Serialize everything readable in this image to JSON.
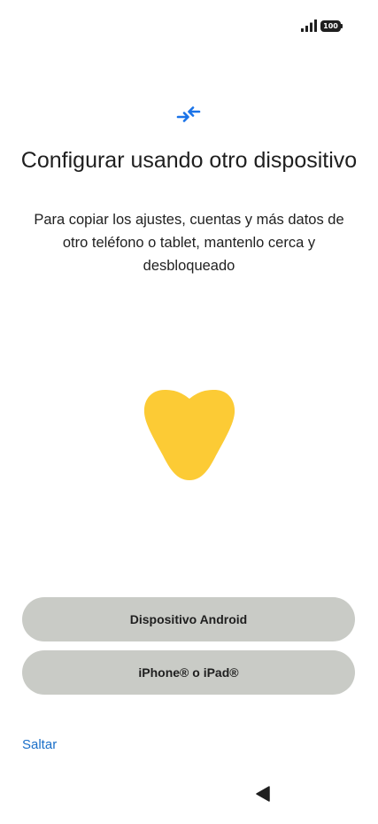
{
  "status_bar": {
    "signal_icon": "signal-bars-icon",
    "battery_level": "100"
  },
  "header": {
    "icon": "transfer-arrows-icon",
    "accent_color": "#1a73e8"
  },
  "title": "Configurar usando otro dispositivo",
  "subtitle": "Para copiar los ajustes, cuentas y más datos de otro teléfono o tablet, mantenlo cerca y desbloqueado",
  "illustration": {
    "shape": "heart-shape",
    "color": "#fccb35"
  },
  "buttons": {
    "android_label": "Dispositivo Android",
    "iphone_label": "iPhone® o iPad®",
    "background_color": "#c9cbc6"
  },
  "skip_label": "Saltar",
  "link_color": "#1a6fc8",
  "nav_bar": {
    "back_icon": "back-triangle-icon"
  }
}
